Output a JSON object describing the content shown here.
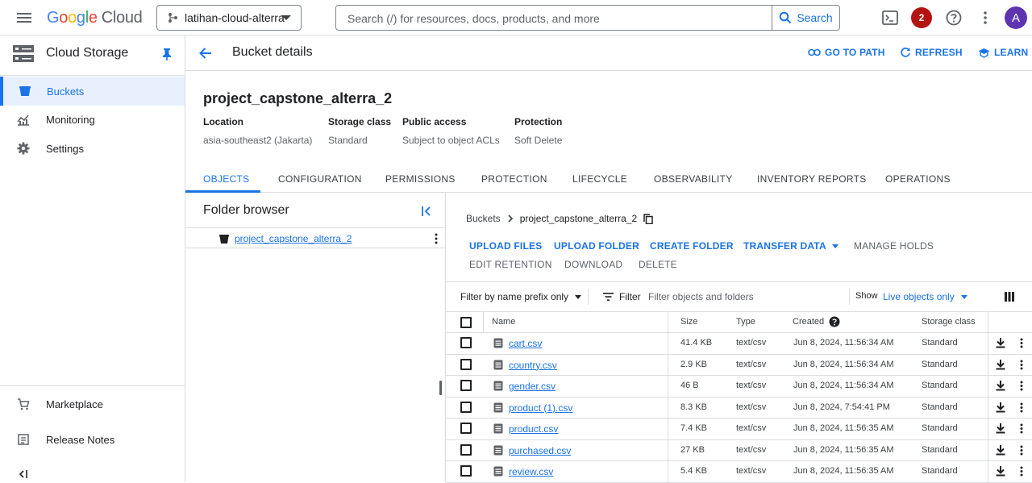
{
  "topbar": {
    "logo_google": "Google",
    "logo_cloud": "Cloud",
    "project_name": "latihan-cloud-alterra",
    "search_placeholder": "Search (/) for resources, docs, products, and more",
    "search_button": "Search",
    "notification_count": "2",
    "avatar_letter": "A",
    "icons": [
      "menu-icon",
      "terminal-icon",
      "help-icon",
      "more-vert-icon"
    ]
  },
  "sidebar": {
    "title": "Cloud Storage",
    "items": [
      {
        "label": "Buckets",
        "icon": "bucket-icon",
        "active": true
      },
      {
        "label": "Monitoring",
        "icon": "monitoring-icon",
        "active": false
      },
      {
        "label": "Settings",
        "icon": "gear-icon",
        "active": false
      }
    ],
    "bottom_items": [
      {
        "label": "Marketplace",
        "icon": "cart-icon"
      },
      {
        "label": "Release Notes",
        "icon": "notes-icon"
      }
    ]
  },
  "header": {
    "title": "Bucket details",
    "go_to_path": "GO TO PATH",
    "refresh": "REFRESH",
    "learn": "LEARN"
  },
  "bucket": {
    "name": "project_capstone_alterra_2",
    "meta": [
      {
        "key": "Location",
        "value": "asia-southeast2 (Jakarta)"
      },
      {
        "key": "Storage class",
        "value": "Standard"
      },
      {
        "key": "Public access",
        "value": "Subject to object ACLs"
      },
      {
        "key": "Protection",
        "value": "Soft Delete"
      }
    ]
  },
  "tabs": [
    "OBJECTS",
    "CONFIGURATION",
    "PERMISSIONS",
    "PROTECTION",
    "LIFECYCLE",
    "OBSERVABILITY",
    "INVENTORY REPORTS",
    "OPERATIONS"
  ],
  "folder_browser": {
    "title": "Folder browser",
    "root": "project_capstone_alterra_2"
  },
  "objects": {
    "breadcrumb_root": "Buckets",
    "breadcrumb_current": "project_capstone_alterra_2",
    "actions_row1": [
      "UPLOAD FILES",
      "UPLOAD FOLDER",
      "CREATE FOLDER",
      "TRANSFER DATA",
      "MANAGE HOLDS"
    ],
    "actions_row2": [
      "EDIT RETENTION",
      "DOWNLOAD",
      "DELETE"
    ],
    "filter_mode": "Filter by name prefix only",
    "filter_label": "Filter",
    "filter_placeholder": "Filter objects and folders",
    "show_label": "Show",
    "show_value": "Live objects only",
    "columns": [
      "Name",
      "Size",
      "Type",
      "Created",
      "Storage class"
    ],
    "rows": [
      {
        "name": "cart.csv",
        "size": "41.4 KB",
        "type": "text/csv",
        "created": "Jun 8, 2024, 11:56:34 AM",
        "class": "Standard"
      },
      {
        "name": "country.csv",
        "size": "2.9 KB",
        "type": "text/csv",
        "created": "Jun 8, 2024, 11:56:34 AM",
        "class": "Standard"
      },
      {
        "name": "gender.csv",
        "size": "46 B",
        "type": "text/csv",
        "created": "Jun 8, 2024, 11:56:34 AM",
        "class": "Standard"
      },
      {
        "name": "product (1).csv",
        "size": "8.3 KB",
        "type": "text/csv",
        "created": "Jun 8, 2024, 7:54:41 PM",
        "class": "Standard"
      },
      {
        "name": "product.csv",
        "size": "7.4 KB",
        "type": "text/csv",
        "created": "Jun 8, 2024, 11:56:35 AM",
        "class": "Standard"
      },
      {
        "name": "purchased.csv",
        "size": "27 KB",
        "type": "text/csv",
        "created": "Jun 8, 2024, 11:56:35 AM",
        "class": "Standard"
      },
      {
        "name": "review.csv",
        "size": "5.4 KB",
        "type": "text/csv",
        "created": "Jun 8, 2024, 11:56:35 AM",
        "class": "Standard"
      }
    ]
  },
  "colors": {
    "accent": "#1a73e8",
    "active_bg": "#e8f0fe",
    "badge": "#b31412",
    "avatar": "#5e35b1"
  }
}
